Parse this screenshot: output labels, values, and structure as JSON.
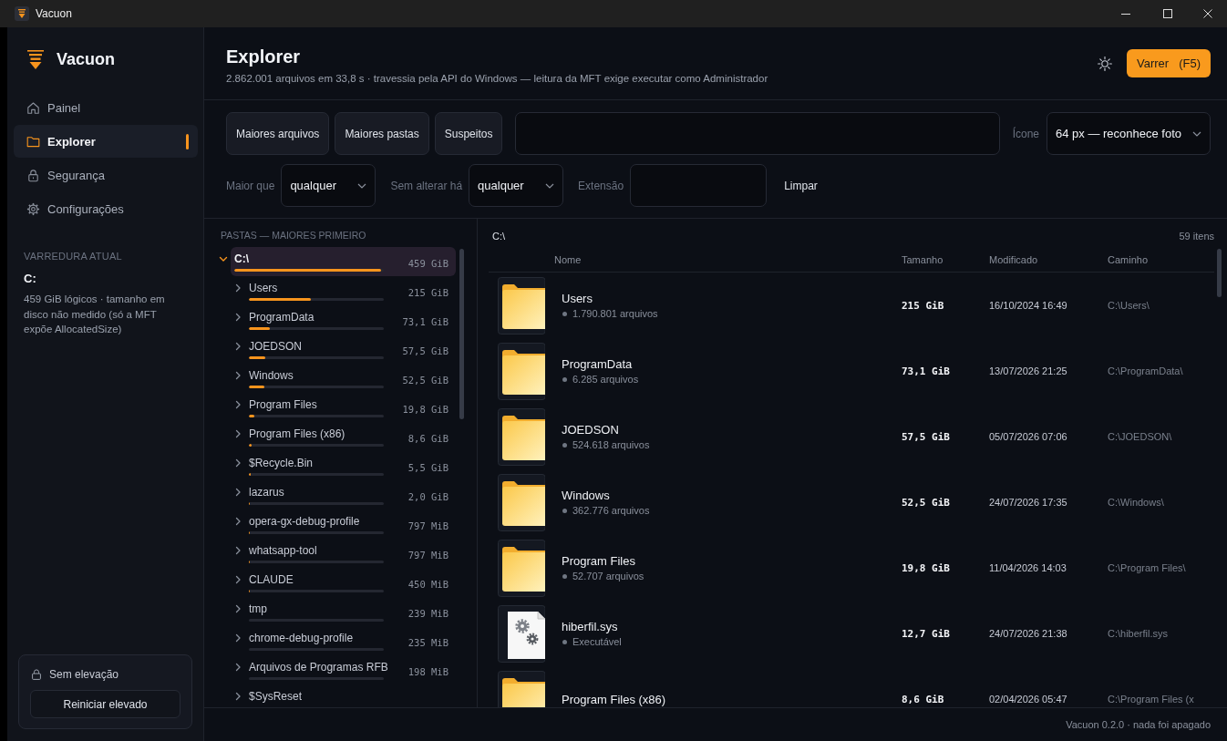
{
  "window": {
    "title": "Vacuon"
  },
  "sidebar": {
    "app_name": "Vacuon",
    "nav": [
      {
        "kind": "dashboard",
        "label": "Painel",
        "selected": false
      },
      {
        "kind": "explorer",
        "label": "Explorer",
        "selected": true
      },
      {
        "kind": "security",
        "label": "Segurança",
        "selected": false
      },
      {
        "kind": "settings",
        "label": "Configurações",
        "selected": false
      }
    ],
    "current_scan": {
      "heading": "VARREDURA ATUAL",
      "drive": "C:",
      "description": "459 GiB lógicos · tamanho em disco não medido (só a MFT expõe AllocatedSize)"
    },
    "elevation": {
      "status": "Sem elevação",
      "button": "Reiniciar elevado"
    }
  },
  "header": {
    "title": "Explorer",
    "subtitle": "2.862.001 arquivos em 33,8 s · travessia pela API do Windows — leitura da MFT exige executar como Administrador",
    "scan_button": {
      "label": "Varrer",
      "shortcut": "(F5)"
    }
  },
  "toolbar": {
    "presets": [
      {
        "label": "Maiores arquivos",
        "selected": false
      },
      {
        "label": "Maiores pastas",
        "selected": false
      },
      {
        "label": "Suspeitos",
        "selected": false
      }
    ],
    "icon_size": {
      "label": "Ícone",
      "value": "64 px — reconhece foto"
    },
    "filters": [
      {
        "kind": "select",
        "label": "Maior que",
        "value": "qualquer"
      },
      {
        "kind": "select",
        "label": "Sem alterar há",
        "value": "qualquer"
      },
      {
        "kind": "text",
        "label": "Extensão"
      }
    ],
    "clear_button": "Limpar"
  },
  "tree": {
    "heading": "PASTAS — MAIORES PRIMEIRO",
    "items": [
      {
        "name": "C:\\",
        "size": "459 GiB",
        "level": 1,
        "expanded": true,
        "selected": true,
        "children": [
          {
            "name": "Users",
            "size": "215 GiB",
            "level": 0.468,
            "expanded": false,
            "selected": false
          },
          {
            "name": "ProgramData",
            "size": "73,1 GiB",
            "level": 0.159,
            "expanded": false,
            "selected": false
          },
          {
            "name": "JOEDSON",
            "size": "57,5 GiB",
            "level": 0.125,
            "expanded": false,
            "selected": false
          },
          {
            "name": "Windows",
            "size": "52,5 GiB",
            "level": 0.114,
            "expanded": false,
            "selected": false
          },
          {
            "name": "Program Files",
            "size": "19,8 GiB",
            "level": 0.043,
            "expanded": false,
            "selected": false
          },
          {
            "name": "Program Files (x86)",
            "size": "8,6 GiB",
            "level": 0.019,
            "expanded": false,
            "selected": false
          },
          {
            "name": "$Recycle.Bin",
            "size": "5,5 GiB",
            "level": 0.012,
            "expanded": false,
            "selected": false
          },
          {
            "name": "lazarus",
            "size": "2,0 GiB",
            "level": 0.004,
            "expanded": false,
            "selected": false
          },
          {
            "name": "opera-gx-debug-profile",
            "size": "797 MiB",
            "level": 0.0017,
            "expanded": false,
            "selected": false
          },
          {
            "name": "whatsapp-tool",
            "size": "797 MiB",
            "level": 0.0017,
            "expanded": false,
            "selected": false
          },
          {
            "name": "CLAUDE",
            "size": "450 MiB",
            "level": 0.001,
            "expanded": false,
            "selected": false
          },
          {
            "name": "tmp",
            "size": "239 MiB",
            "level": 0.0005,
            "expanded": false,
            "selected": false
          },
          {
            "name": "chrome-debug-profile",
            "size": "235 MiB",
            "level": 0.0005,
            "expanded": false,
            "selected": false
          },
          {
            "name": "Arquivos de Programas RFB",
            "size": "198 MiB",
            "level": 0.0004,
            "expanded": false,
            "selected": false
          },
          {
            "name": "$SysReset",
            "expanded": false,
            "selected": false
          }
        ]
      }
    ]
  },
  "listing": {
    "path": "C:\\",
    "count": "59 itens",
    "columns": [
      "Nome",
      "Tamanho",
      "Modificado",
      "Caminho"
    ],
    "rows": [
      {
        "kind": "folder",
        "name": "Users",
        "detail": "1.790.801 arquivos",
        "size": "215 GiB",
        "modified": "16/10/2024 16:49",
        "path": "C:\\Users\\"
      },
      {
        "kind": "folder",
        "name": "ProgramData",
        "detail": "6.285 arquivos",
        "size": "73,1 GiB",
        "modified": "13/07/2026 21:25",
        "path": "C:\\ProgramData\\"
      },
      {
        "kind": "folder",
        "name": "JOEDSON",
        "detail": "524.618 arquivos",
        "size": "57,5 GiB",
        "modified": "05/07/2026 07:06",
        "path": "C:\\JOEDSON\\"
      },
      {
        "kind": "folder",
        "name": "Windows",
        "detail": "362.776 arquivos",
        "size": "52,5 GiB",
        "modified": "24/07/2026 17:35",
        "path": "C:\\Windows\\"
      },
      {
        "kind": "folder",
        "name": "Program Files",
        "detail": "52.707 arquivos",
        "size": "19,8 GiB",
        "modified": "11/04/2026 14:03",
        "path": "C:\\Program Files\\"
      },
      {
        "kind": "system_file",
        "name": "hiberfil.sys",
        "detail": "Executável",
        "size": "12,7 GiB",
        "modified": "24/07/2026 21:38",
        "path": "C:\\hiberfil.sys"
      },
      {
        "kind": "folder",
        "name": "Program Files (x86)",
        "size": "8,6 GiB",
        "modified": "02/04/2026 05:47",
        "path": "C:\\Program Files (x"
      }
    ]
  },
  "status_bar": "Vacuon 0.2.0 · nada foi apagado"
}
